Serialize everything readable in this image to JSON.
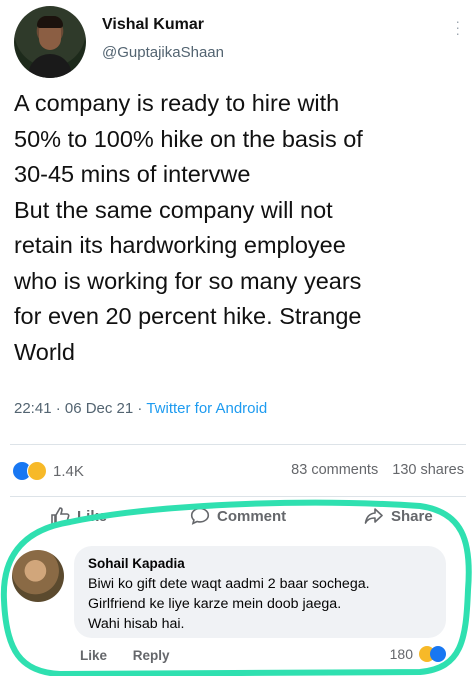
{
  "tweet": {
    "author_name": "Vishal Kumar",
    "author_handle": "@GuptajikaShaan",
    "text": "A company is ready to hire with\n50% to 100% hike on the basis of\n30-45 mins of intervwe\nBut the same company will not\nretain its hardworking employee\nwho is working for so many years\nfor even 20 percent hike. Strange\nWorld",
    "timestamp": "22:41 · 06 Dec 21 · ",
    "source": "Twitter for Android"
  },
  "post": {
    "reaction_count": "1.4K",
    "comments_count": "83 comments",
    "shares_count": "130 shares",
    "actions": {
      "like": "Like",
      "comment": "Comment",
      "share": "Share"
    }
  },
  "comment": {
    "author": "Sohail Kapadia",
    "lines": [
      "Biwi ko gift dete waqt aadmi 2 baar sochega.",
      "Girlfriend ke liye karze mein doob jaega.",
      "Wahi hisab hai."
    ],
    "actions": {
      "like": "Like",
      "reply": "Reply"
    },
    "reaction_count": "180"
  },
  "colors": {
    "highlight": "#2fe0b0",
    "link": "#1d9bf0",
    "like_blue": "#1877f2"
  }
}
